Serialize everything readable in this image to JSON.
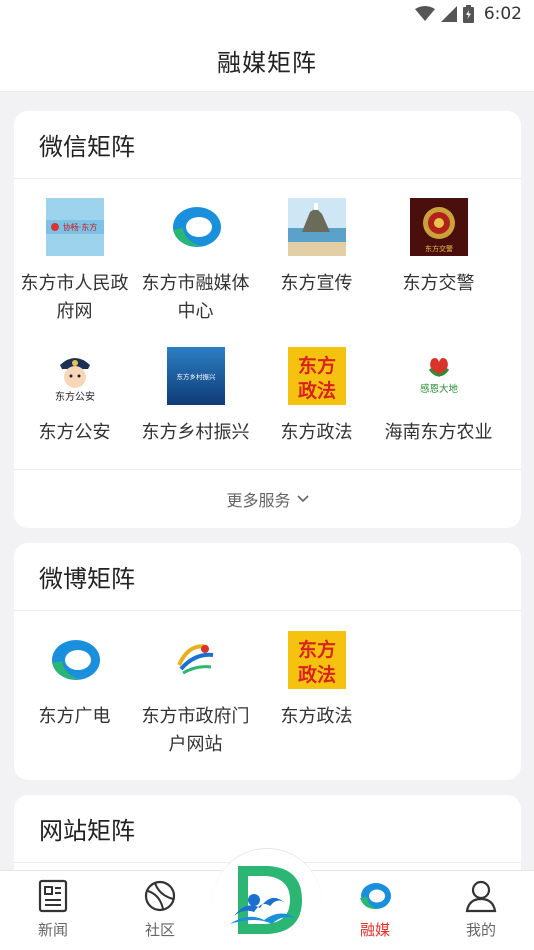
{
  "status": {
    "time": "6:02"
  },
  "header": {
    "title": "融媒矩阵"
  },
  "wechat": {
    "title": "微信矩阵",
    "items": [
      {
        "label": "东方市人民政府网",
        "icon": "dongfang-gov-icon"
      },
      {
        "label": "东方市融媒体中心",
        "icon": "rongmei-center-icon"
      },
      {
        "label": "东方宣传",
        "icon": "dongfang-publicity-icon"
      },
      {
        "label": "东方交警",
        "icon": "traffic-police-icon"
      },
      {
        "label": "东方公安",
        "icon": "public-security-icon"
      },
      {
        "label": "东方乡村振兴",
        "icon": "rural-revitalization-icon"
      },
      {
        "label": "东方政法",
        "icon": "politics-law-icon"
      },
      {
        "label": "海南东方农业",
        "icon": "agriculture-icon"
      }
    ],
    "more_label": "更多服务"
  },
  "weibo": {
    "title": "微博矩阵",
    "items": [
      {
        "label": "东方广电",
        "icon": "broadcast-icon"
      },
      {
        "label": "东方市政府门户网站",
        "icon": "gov-portal-icon"
      },
      {
        "label": "东方政法",
        "icon": "politics-law-icon"
      }
    ]
  },
  "website": {
    "title": "网站矩阵"
  },
  "icon_text": {
    "gov_banner": "协畅·东方",
    "police_badge": "东方交警",
    "public_security": "东方公安",
    "rural": "东方乡村振兴",
    "zhengfa_1": "东方",
    "zhengfa_2": "政法",
    "agri": "感恩大地"
  },
  "tabbar": {
    "items": [
      {
        "label": "新闻",
        "icon": "news-icon",
        "active": false
      },
      {
        "label": "社区",
        "icon": "community-icon",
        "active": false
      },
      {
        "label": "融媒",
        "icon": "rongmei-icon",
        "active": true
      },
      {
        "label": "我的",
        "icon": "profile-icon",
        "active": false
      }
    ]
  },
  "colors": {
    "accent": "#e0302a",
    "brand_blue": "#1a8fdc",
    "brand_green": "#2bb673"
  }
}
